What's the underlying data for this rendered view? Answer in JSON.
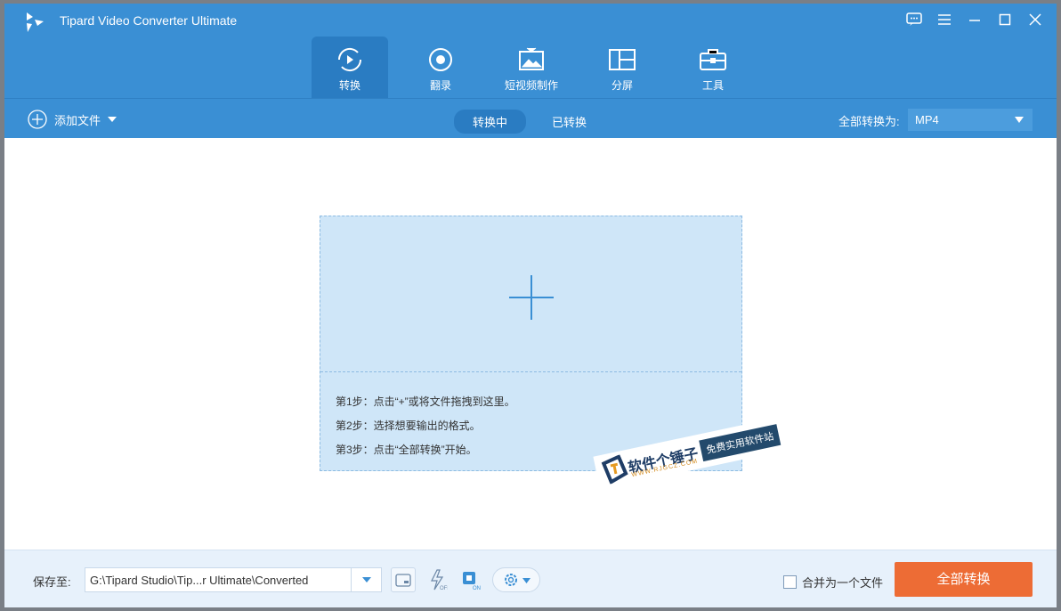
{
  "app": {
    "title": "Tipard Video Converter Ultimate"
  },
  "window_controls": [
    "feedback-icon",
    "menu-icon",
    "minimize-icon",
    "maximize-icon",
    "close-icon"
  ],
  "tabs": [
    {
      "label": "转换",
      "active": true
    },
    {
      "label": "翻录"
    },
    {
      "label": "短视频制作"
    },
    {
      "label": "分屏"
    },
    {
      "label": "工具"
    }
  ],
  "toolbar": {
    "add_files": "添加文件",
    "segments": [
      "转换中",
      "已转换"
    ],
    "convert_all_to_label": "全部转换为:",
    "format": "MP4"
  },
  "dropzone": {
    "steps": [
      "第1步：点击“+”或将文件拖拽到这里。",
      "第2步：选择想要输出的格式。",
      "第3步：点击“全部转换”开始。"
    ]
  },
  "watermark": {
    "title": "软件个锤子",
    "url": "WWW.RJGCZ.COM",
    "slogan": "免费实用软件站"
  },
  "bottom": {
    "save_to_label": "保存至:",
    "path": "G:\\Tipard Studio\\Tip...r Ultimate\\Converted",
    "merge_label": "合并为一个文件",
    "merge_checked": false,
    "convert_all": "全部转换"
  },
  "colors": {
    "primary": "#3a8fd4",
    "accent": "#ed6c35"
  }
}
